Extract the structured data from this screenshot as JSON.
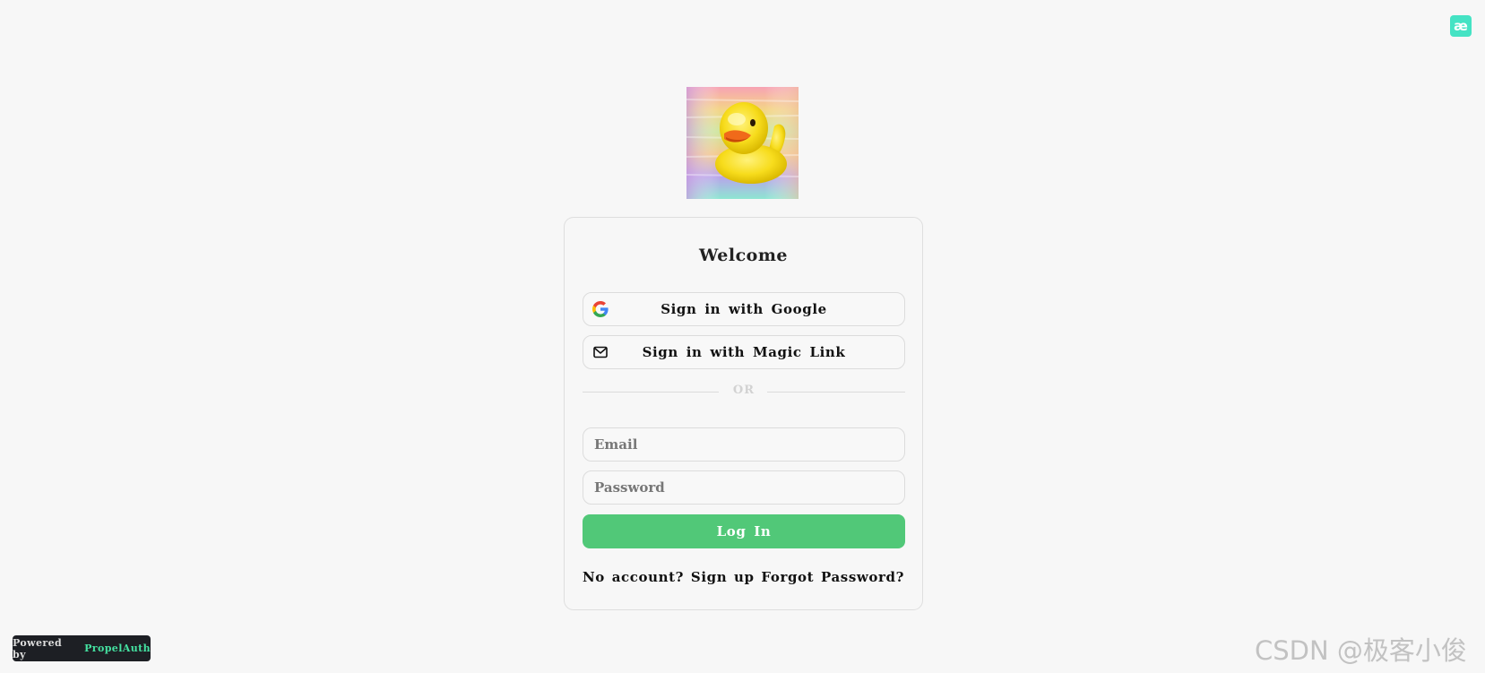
{
  "corner_logo": {
    "icon": "ae-logo-icon",
    "glyph": "æ",
    "color": "#45e3c4"
  },
  "logo": {
    "icon": "rubber-duck-logo"
  },
  "card": {
    "title": "Welcome",
    "google_button": {
      "label": "Sign in with Google",
      "icon": "google-icon"
    },
    "magic_link_button": {
      "label": "Sign in with Magic Link",
      "icon": "mail-icon"
    },
    "divider_text": "OR",
    "email": {
      "placeholder": "Email",
      "value": ""
    },
    "password": {
      "placeholder": "Password",
      "value": ""
    },
    "login_button": {
      "label": "Log In",
      "color": "#51c878"
    },
    "signup_link": "No account? Sign up",
    "forgot_link": "Forgot Password?"
  },
  "footer": {
    "powered_prefix": "Powered by",
    "powered_brand": "PropelAuth",
    "brand_color": "#45e3a2"
  },
  "watermark": "CSDN @极客小俊"
}
